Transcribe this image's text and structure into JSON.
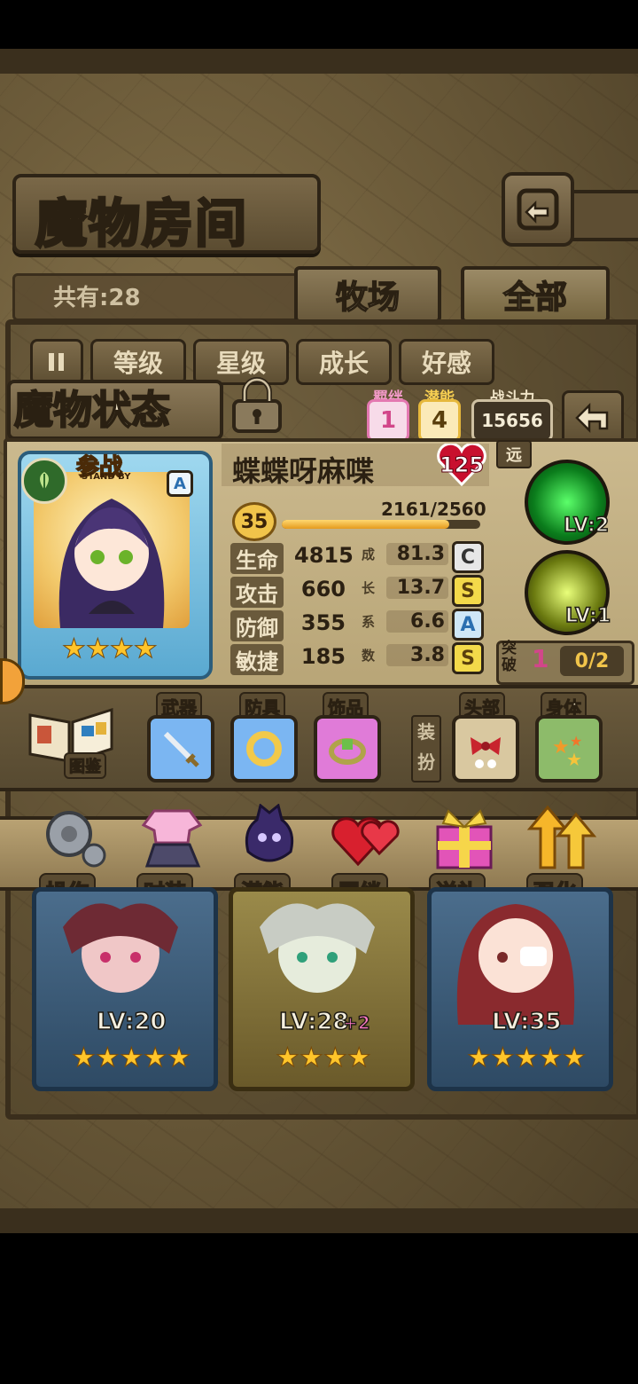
{
  "header": {
    "title": "魔物房间"
  },
  "count": {
    "label": "共有:28"
  },
  "tabs": [
    {
      "label": "牧场"
    },
    {
      "label": "全部"
    }
  ],
  "sort_buttons": [
    {
      "label": "等级"
    },
    {
      "label": "星级"
    },
    {
      "label": "成长"
    },
    {
      "label": "好感"
    }
  ],
  "status": {
    "title": "魔物状态",
    "bond": {
      "label": "羁绊",
      "value": "1"
    },
    "potential": {
      "label": "潜能",
      "value": "4"
    },
    "power": {
      "label": "战斗力",
      "value": "15656"
    }
  },
  "monster": {
    "standby_label": "参战",
    "standby_sub": "STAND BY",
    "rank": "A",
    "name": "蝶蝶呀麻喋",
    "affection": "125",
    "range": "远",
    "level": "35",
    "exp": "2161/2560",
    "exp_fraction": 0.844,
    "stars": 4,
    "stats": [
      {
        "label": "生命",
        "value": "4815",
        "growth": "81.3",
        "grade": "C"
      },
      {
        "label": "攻击",
        "value": "660",
        "growth": "13.7",
        "grade": "S"
      },
      {
        "label": "防御",
        "value": "355",
        "growth": "6.6",
        "grade": "A"
      },
      {
        "label": "敏捷",
        "value": "185",
        "growth": "3.8",
        "grade": "S"
      }
    ],
    "growth_label": [
      "成",
      "长",
      "系",
      "数"
    ]
  },
  "skills": [
    {
      "level": "LV:2"
    },
    {
      "level": "LV:1"
    }
  ],
  "breakthrough": {
    "label1": "突",
    "label2": "破",
    "value": "1",
    "progress": "0/2"
  },
  "equipment": {
    "book_label": "图鉴",
    "slots": [
      {
        "label": "武器"
      },
      {
        "label": "防具"
      },
      {
        "label": "饰品"
      }
    ],
    "dress_label": [
      "装",
      "扮"
    ],
    "costume": [
      {
        "label": "头部"
      },
      {
        "label": "身体"
      }
    ]
  },
  "actions": [
    {
      "label": "操作"
    },
    {
      "label": "时装"
    },
    {
      "label": "潜能"
    },
    {
      "label": "羁绊"
    },
    {
      "label": "送礼"
    },
    {
      "label": "强化"
    }
  ],
  "cards": [
    {
      "level": "LV:20",
      "bonus": "",
      "stars": 5
    },
    {
      "level": "LV:28",
      "bonus": "+2",
      "stars": 4
    },
    {
      "level": "LV:35",
      "bonus": "",
      "stars": 5
    }
  ]
}
